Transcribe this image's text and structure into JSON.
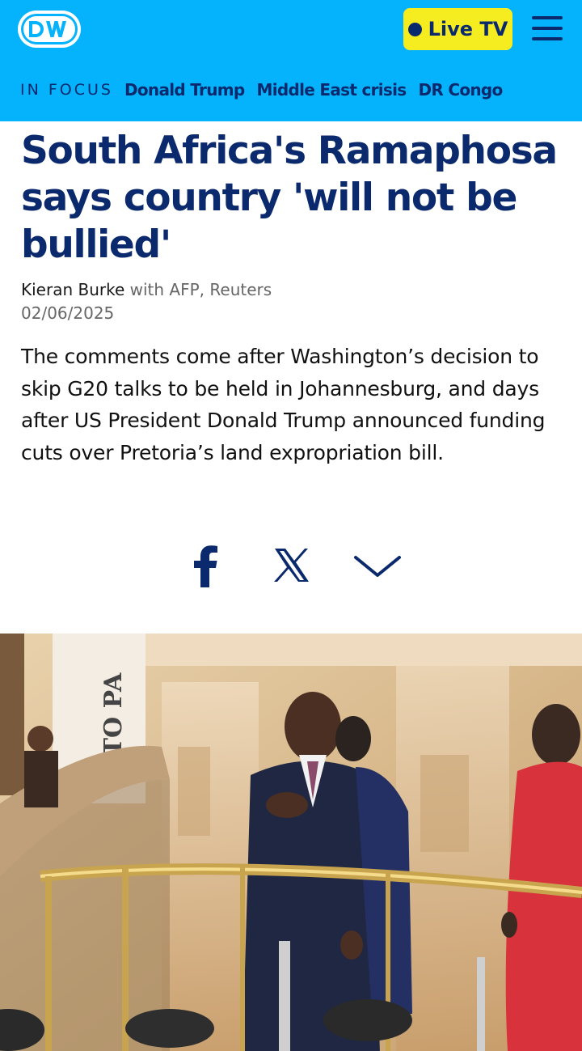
{
  "header": {
    "logo": "DW",
    "live_tv_label": "Live TV",
    "menu_icon": "hamburger-menu-icon",
    "background_color": "#05b2fc",
    "accent_color": "#0b2a6e",
    "live_button_color": "#f6ed21"
  },
  "in_focus": {
    "label": "IN FOCUS",
    "links": [
      "Donald Trump",
      "Middle East crisis",
      "DR Congo"
    ]
  },
  "article": {
    "headline": "South Africa's Ramaphosa says country 'will not be bullied'",
    "author": "Kieran Burke",
    "agencies": "with AFP, Reuters",
    "date": "02/06/2025",
    "teaser": "The comments come after Washington’s decision to skip G20 talks to be held in Johannesburg, and days after US President Donald Trump announced funding cuts over Pretoria’s land expropriation bill."
  },
  "share": {
    "icons": [
      "facebook-icon",
      "x-icon",
      "chevron-down-icon"
    ]
  },
  "hero_image": {
    "sign_text": "TO PA"
  }
}
